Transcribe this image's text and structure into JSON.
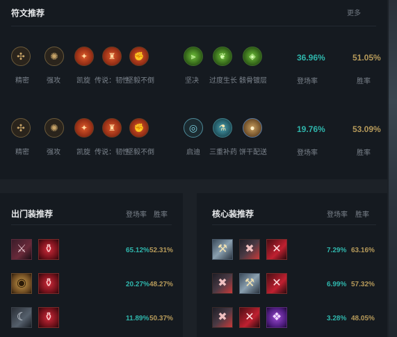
{
  "runes": {
    "title": "符文推荐",
    "more": "更多",
    "rows": [
      {
        "primary": [
          {
            "icon": "precision-icon",
            "label": "精密"
          },
          {
            "icon": "keystone-icon",
            "label": "强攻"
          },
          {
            "icon": "triumph-icon",
            "label": "凯旋"
          },
          {
            "icon": "legend-icon",
            "label": "传说：韧性"
          },
          {
            "icon": "last-stand-icon",
            "label": "坚毅不倒"
          }
        ],
        "secondary": [
          {
            "icon": "resolve-icon",
            "label": "坚决"
          },
          {
            "icon": "overgrowth-icon",
            "label": "过度生长"
          },
          {
            "icon": "bone-plating-icon",
            "label": "骸骨镀层"
          }
        ],
        "appear_rate": "36.96%",
        "win_rate": "51.05%",
        "appear_label": "登场率",
        "win_label": "胜率"
      },
      {
        "primary": [
          {
            "icon": "precision-icon",
            "label": "精密"
          },
          {
            "icon": "keystone-icon",
            "label": "强攻"
          },
          {
            "icon": "triumph-icon",
            "label": "凯旋"
          },
          {
            "icon": "legend-icon",
            "label": "传说：韧性"
          },
          {
            "icon": "last-stand-icon",
            "label": "坚毅不倒"
          }
        ],
        "secondary": [
          {
            "icon": "inspiration-icon",
            "label": "启迪"
          },
          {
            "icon": "triple-tonic-icon",
            "label": "三重补药"
          },
          {
            "icon": "biscuit-icon",
            "label": "饼干配送"
          }
        ],
        "appear_rate": "19.76%",
        "win_rate": "53.09%",
        "appear_label": "登场率",
        "win_label": "胜率"
      }
    ]
  },
  "start_items": {
    "title": "出门装推荐",
    "col_appear": "登场率",
    "col_win": "胜率",
    "rows": [
      {
        "items": [
          "blade-icon",
          "health-potion-icon"
        ],
        "appear": "65.12%",
        "win": "52.31%"
      },
      {
        "items": [
          "shield-icon",
          "health-potion-icon"
        ],
        "appear": "20.27%",
        "win": "48.27%"
      },
      {
        "items": [
          "axe-icon",
          "health-potion-icon"
        ],
        "appear": "11.89%",
        "win": "50.37%"
      }
    ]
  },
  "core_items": {
    "title": "核心装推荐",
    "col_appear": "登场率",
    "col_win": "胜率",
    "rows": [
      {
        "items": [
          "steel-hammer-icon",
          "dark-blade-icon",
          "crimson-axe-icon"
        ],
        "appear": "7.29%",
        "win": "63.16%"
      },
      {
        "items": [
          "dark-blade-icon",
          "steel-hammer-icon",
          "crimson-axe-icon"
        ],
        "appear": "6.99%",
        "win": "57.32%"
      },
      {
        "items": [
          "dark-blade-icon",
          "crimson-axe-icon",
          "purple-orb-icon"
        ],
        "appear": "3.28%",
        "win": "48.05%"
      }
    ]
  }
}
